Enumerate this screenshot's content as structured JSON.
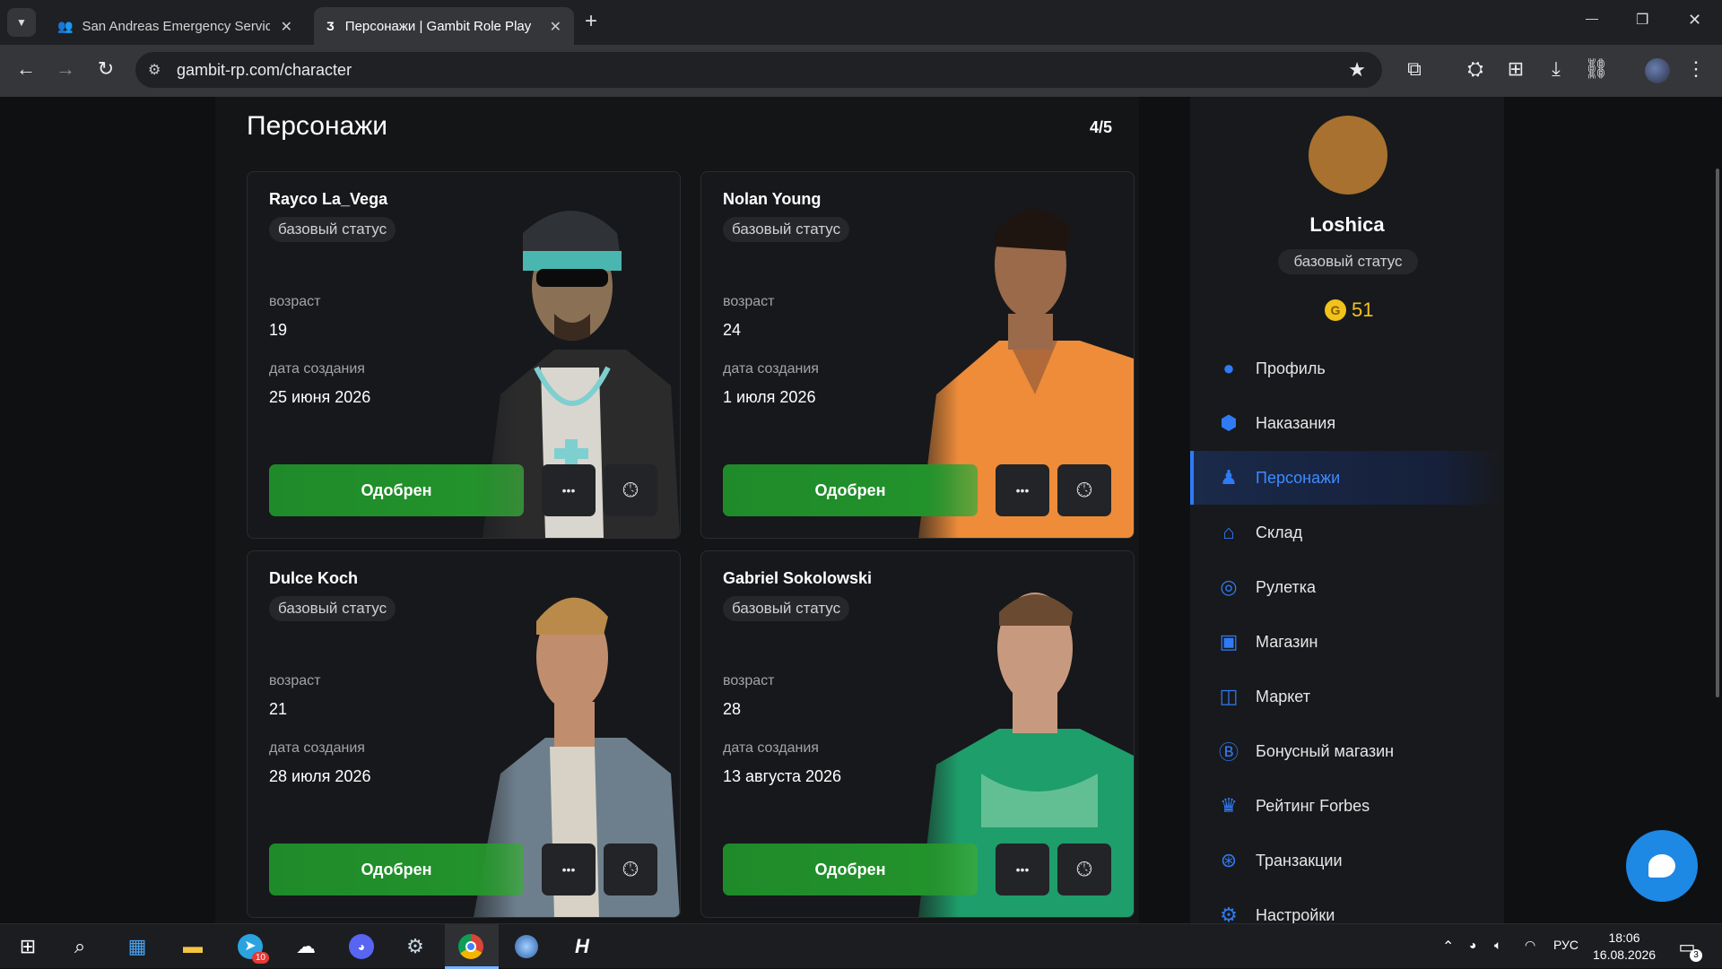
{
  "browser": {
    "tabs": [
      {
        "title": "San Andreas Emergency Service",
        "close": "✕"
      },
      {
        "title": "Персонажи | Gambit Role Play",
        "close": "✕"
      }
    ],
    "new_tab": "+",
    "url": "gambit-rp.com/character",
    "window": {
      "minimize": "—",
      "restore": "❐",
      "close": "✕"
    }
  },
  "page": {
    "title": "Персонажи",
    "count": "4/5",
    "characters": [
      {
        "name": "Rayco La_Vega",
        "status": "базовый статус",
        "age_label": "возраст",
        "age": "19",
        "created_label": "дата создания",
        "created": "25 июня 2026",
        "button": "Одобрен",
        "more": "•••",
        "history_icon": "clock-icon"
      },
      {
        "name": "Nolan Young",
        "status": "базовый статус",
        "age_label": "возраст",
        "age": "24",
        "created_label": "дата создания",
        "created": "1 июля 2026",
        "button": "Одобрен",
        "more": "•••",
        "history_icon": "clock-icon"
      },
      {
        "name": "Dulce Koch",
        "status": "базовый статус",
        "age_label": "возраст",
        "age": "21",
        "created_label": "дата создания",
        "created": "28 июля 2026",
        "button": "Одобрен",
        "more": "•••",
        "history_icon": "clock-icon"
      },
      {
        "name": "Gabriel Sokolowski",
        "status": "базовый статус",
        "age_label": "возраст",
        "age": "28",
        "created_label": "дата создания",
        "created": "13 августа 2026",
        "button": "Одобрен",
        "more": "•••",
        "history_icon": "clock-icon"
      }
    ]
  },
  "sidebar": {
    "username": "Loshica",
    "status": "базовый статус",
    "coins": "51",
    "coin_symbol": "G",
    "menu": [
      {
        "label": "Профиль",
        "icon": "user-icon"
      },
      {
        "label": "Наказания",
        "icon": "warning-icon"
      },
      {
        "label": "Персонажи",
        "icon": "person-icon",
        "active": true
      },
      {
        "label": "Склад",
        "icon": "warehouse-icon"
      },
      {
        "label": "Рулетка",
        "icon": "roulette-icon"
      },
      {
        "label": "Магазин",
        "icon": "store-icon"
      },
      {
        "label": "Маркет",
        "icon": "bag-icon"
      },
      {
        "label": "Бонусный магазин",
        "icon": "bonus-icon"
      },
      {
        "label": "Рейтинг Forbes",
        "icon": "trophy-icon"
      },
      {
        "label": "Транзакции",
        "icon": "transactions-icon"
      },
      {
        "label": "Настройки",
        "icon": "gear-icon"
      }
    ]
  },
  "taskbar": {
    "telegram_badge": "10",
    "lang": "РУС",
    "time": "18:06",
    "date": "16.08.2026",
    "notif_count": "3"
  },
  "colors": {
    "accent": "#2f7bf5",
    "approved": "#1f8a2a",
    "avatar": "#a8712f",
    "coin": "#f1c21b"
  }
}
